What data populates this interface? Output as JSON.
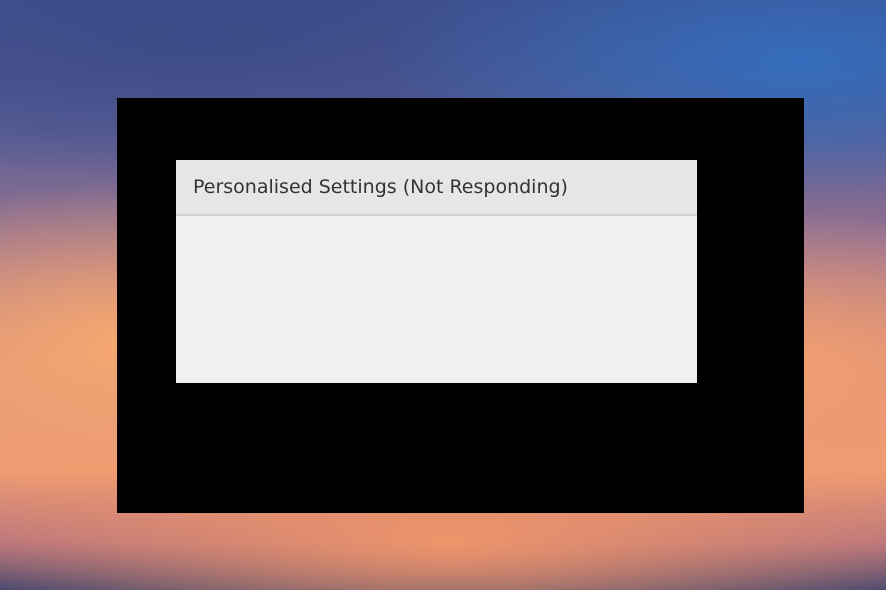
{
  "window": {
    "title": "Personalised Settings (Not Responding)"
  },
  "colors": {
    "frame": "#000000",
    "titlebar": "#e6e6e6",
    "window_body": "#f0f0f0",
    "title_text": "#333333"
  }
}
